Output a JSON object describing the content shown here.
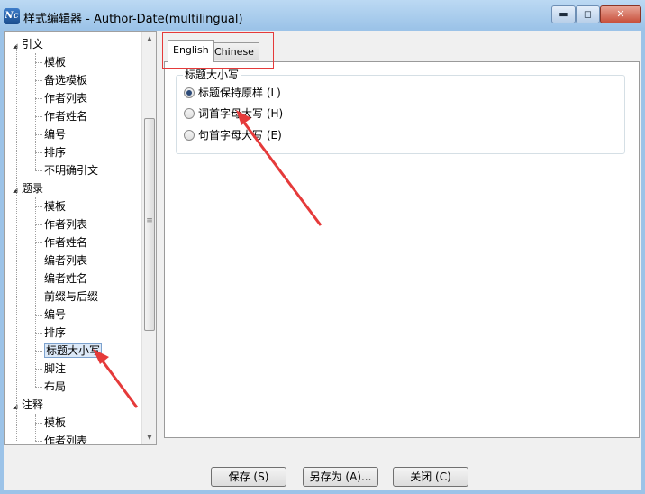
{
  "window": {
    "app_icon_text": "Nc",
    "title": "样式编辑器 - Author-Date(multilingual)",
    "min_glyph": "▬",
    "max_glyph": "◻",
    "close_glyph": "✕"
  },
  "tree": {
    "expander_glyph": "◢",
    "groups": [
      {
        "label": "引文",
        "children": [
          "模板",
          "备选模板",
          "作者列表",
          "作者姓名",
          "编号",
          "排序",
          "不明确引文"
        ]
      },
      {
        "label": "题录",
        "children": [
          "模板",
          "作者列表",
          "作者姓名",
          "编者列表",
          "编者姓名",
          "前缀与后缀",
          "编号",
          "排序",
          "标题大小写",
          "脚注",
          "布局"
        ]
      },
      {
        "label": "注释",
        "children": [
          "模板",
          "作者列表"
        ]
      }
    ],
    "selected": "标题大小写",
    "scroll_up": "▲",
    "scroll_down": "▼",
    "thumb_grip": "≡"
  },
  "tabs": {
    "english": "English",
    "chinese": "Chinese"
  },
  "title_case_group": {
    "title": "标题大小写",
    "options": [
      {
        "label": "标题保持原样 (L)",
        "checked": true
      },
      {
        "label": "词首字母大写 (H)",
        "checked": false
      },
      {
        "label": "句首字母大写 (E)",
        "checked": false
      }
    ]
  },
  "buttons": {
    "save": "保存 (S)",
    "save_as": "另存为 (A)...",
    "close": "关闭 (C)"
  },
  "colors": {
    "annotation": "#e53a3a",
    "frame": "#9cc3e8"
  }
}
